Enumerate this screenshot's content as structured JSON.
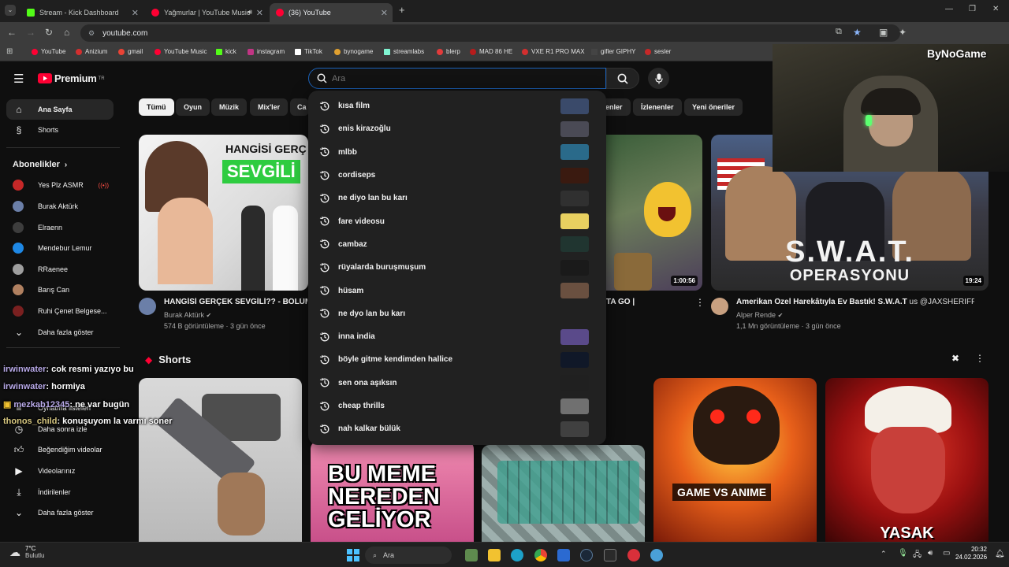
{
  "tabs": [
    {
      "title": "Stream - Kick Dashboard",
      "favicon_color": "#53fc18"
    },
    {
      "title": "Yağmurlar | YouTube Music",
      "favicon_color": "#ff0033"
    },
    {
      "title": "(36) YouTube",
      "favicon_color": "#ff0033"
    }
  ],
  "address": {
    "url": "youtube.com"
  },
  "bookmarks": [
    {
      "label": "YouTube",
      "color": "#ff0033"
    },
    {
      "label": "Anizium",
      "color": "#d32f2f"
    },
    {
      "label": "gmail",
      "color": "#ea4335"
    },
    {
      "label": "YouTube Music",
      "color": "#ff0033"
    },
    {
      "label": "kick",
      "color": "#53fc18"
    },
    {
      "label": "instagram",
      "color": "#c13584"
    },
    {
      "label": "TikTok",
      "color": "#ffffff"
    },
    {
      "label": "bynogame",
      "color": "#e0a030"
    },
    {
      "label": "streamlabs",
      "color": "#80f5d2"
    },
    {
      "label": "blerp",
      "color": "#e33b3b"
    },
    {
      "label": "MAD 86 HE",
      "color": "#b71c1c"
    },
    {
      "label": "VXE R1 PRO MAX",
      "color": "#d32f2f"
    },
    {
      "label": "gifler GIPHY",
      "color": "#444444"
    },
    {
      "label": "sesler",
      "color": "#c62828"
    }
  ],
  "youtube": {
    "logo_text": "Premium",
    "logo_sup": "TR",
    "search_placeholder": "Ara"
  },
  "sidebar": {
    "main": [
      {
        "label": "Ana Sayfa",
        "icon": "home-icon",
        "active": true
      },
      {
        "label": "Shorts",
        "icon": "shorts-icon",
        "active": false
      }
    ],
    "subscriptions_header": "Abonelikler",
    "subscriptions": [
      {
        "label": "Yes Plz ASMR",
        "color": "#c62828",
        "live": true
      },
      {
        "label": "Burak Aktürk",
        "color": "#6b7fa8",
        "live": false
      },
      {
        "label": "Elraenn",
        "color": "#3d3d3d",
        "live": false
      },
      {
        "label": "Mendebur Lemur",
        "color": "#1e88e5",
        "live": false
      },
      {
        "label": "RRaenee",
        "color": "#9e9e9e",
        "live": false
      },
      {
        "label": "Barış Can",
        "color": "#b08060",
        "live": false
      },
      {
        "label": "Ruhi Çenet Belgese...",
        "color": "#7a2020",
        "live": false
      }
    ],
    "show_more": "Daha fazla göster",
    "you_items": [
      {
        "label": "Oynatma listeleri",
        "icon": "playlist-icon"
      },
      {
        "label": "Daha sonra izle",
        "icon": "clock-icon"
      },
      {
        "label": "Beğendiğim videolar",
        "icon": "like-icon"
      },
      {
        "label": "Videolarınız",
        "icon": "video-icon"
      },
      {
        "label": "İndirilenler",
        "icon": "download-icon"
      },
      {
        "label": "Daha fazla göster",
        "icon": "chevron-down-icon"
      }
    ]
  },
  "chips": [
    {
      "label": "Tümü",
      "active": true
    },
    {
      "label": "Oyun",
      "active": false
    },
    {
      "label": "Müzik",
      "active": false
    },
    {
      "label": "Mix'ler",
      "active": false
    },
    {
      "label": "Ca",
      "active": false
    },
    {
      "label": "enler",
      "active": false
    },
    {
      "label": "İzlenenler",
      "active": false
    },
    {
      "label": "Yeni öneriler",
      "active": false
    }
  ],
  "videos": [
    {
      "title": "HANGİSİ GERÇEK SEVGİLİ?? - BÖLÜM",
      "channel": "Burak Aktürk",
      "meta": "574 B görüntüleme · 3 gün önce",
      "thumb_text_1": "HANGİSİ GERÇ",
      "thumb_text_2": "SEVGİLİ"
    },
    {
      "title": "TA GO |",
      "duration": "1:00:56"
    },
    {
      "title": "Amerikan Özel Harekâtıyla Ev Bastık! S.W.A.T",
      "title_suffix": "us @JAXSHERIFF",
      "channel": "Alper Rende",
      "meta": "1,1 Mn görüntüleme · 3 gün önce",
      "duration": "19:24",
      "thumb_text_1": "S.W.A.T.",
      "thumb_text_2": "OPERASYONU"
    }
  ],
  "shorts": {
    "header": "Shorts",
    "items": [
      {
        "text": ""
      },
      {
        "text": "BU MEME NEREDEN GELİYOR"
      },
      {
        "text": ""
      },
      {
        "text": "GAME VS ANIME"
      },
      {
        "text": "YASAK"
      }
    ]
  },
  "suggestions": [
    {
      "text": "kısa film",
      "thumb": "#3a4a6a"
    },
    {
      "text": "enis kirazoğlu",
      "thumb": "#4a4a55"
    },
    {
      "text": "mlbb",
      "thumb": "#2a6a8a"
    },
    {
      "text": "cordiseps",
      "thumb": "#3a1a10"
    },
    {
      "text": "ne diyo lan bu karı",
      "thumb": "#303030"
    },
    {
      "text": "fare videosu",
      "thumb": "#e8d060"
    },
    {
      "text": "cambaz",
      "thumb": "#203530"
    },
    {
      "text": "rüyalarda buruşmuşum",
      "thumb": "#1a1a1a"
    },
    {
      "text": "hüsam",
      "thumb": "#6a5040"
    },
    {
      "text": "ne dyo lan bu karı",
      "thumb": ""
    },
    {
      "text": "inna india",
      "thumb": "#5a4a8a"
    },
    {
      "text": "böyle gitme kendimden hallice",
      "thumb": "#101828"
    },
    {
      "text": "sen ona aşıksın",
      "thumb": "#202020"
    },
    {
      "text": "cheap thrills",
      "thumb": "#707070"
    },
    {
      "text": "nah kalkar bülük",
      "thumb": "#404040"
    }
  ],
  "chat": [
    {
      "user": "irwinwater",
      "msg": ": cok resmi yazıyo bu"
    },
    {
      "user": "irwinwater",
      "msg": ": hormiya"
    },
    {
      "user": "mezkab12345",
      "msg": ": ne var bugün"
    },
    {
      "user": "thonos_child",
      "msg": ": konuşuyom la varmı soner"
    }
  ],
  "webcam": {
    "watermark": "ByNoGame"
  },
  "taskbar": {
    "weather_temp": "7°C",
    "weather_desc": "Bulutlu",
    "search_label": "Ara",
    "time": "20:32",
    "date": "24.02.2026"
  }
}
